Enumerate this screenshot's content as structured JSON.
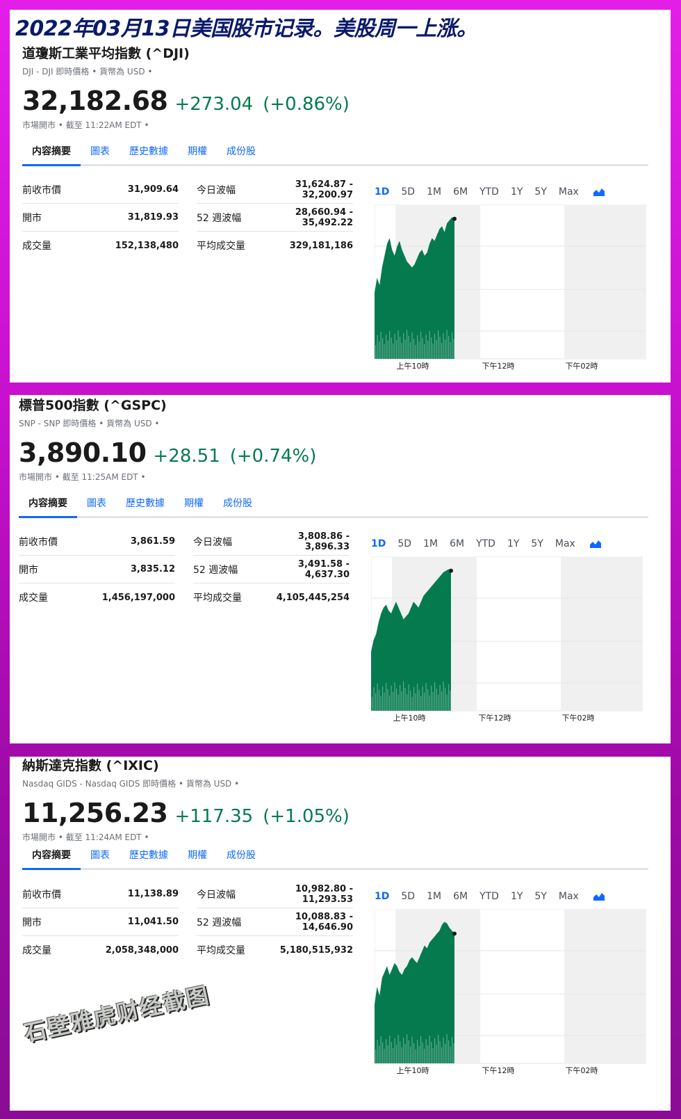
{
  "headline": "2022年03月13日美国股市记录。美股周一上涨。",
  "watermark": "石壁雅虎财经截图",
  "tabs": [
    "内容摘要",
    "圖表",
    "歷史數據",
    "期權",
    "成份股"
  ],
  "ranges": [
    "1D",
    "5D",
    "1M",
    "6M",
    "YTD",
    "1Y",
    "5Y",
    "Max"
  ],
  "x_labels": [
    "上午10時",
    "下午12時",
    "下午02時"
  ],
  "colors": {
    "up": "#067a4f",
    "link": "#0f69ff",
    "chart_fill": "#067a4f",
    "bg": "#d11bd6"
  },
  "quotes": [
    {
      "title": "道瓊斯工業平均指數 (^DJI)",
      "sub": "DJI - DJI 即時價格 • 貨幣為 USD •",
      "price": "32,182.68",
      "change": "+273.04",
      "pct": "(+0.86%)",
      "status": "市場開市 •  截至 11:22AM EDT •",
      "stats_left": [
        {
          "label": "前收市價",
          "value": "31,909.64"
        },
        {
          "label": "開市",
          "value": "31,819.93"
        },
        {
          "label": "成交量",
          "value": "152,138,480"
        }
      ],
      "stats_right": [
        {
          "label": "今日波幅",
          "value1": "31,624.87 -",
          "value2": "32,200.97"
        },
        {
          "label": "52 週波幅",
          "value1": "28,660.94 -",
          "value2": "35,492.22"
        },
        {
          "label": "平均成交量",
          "value1": "329,181,186",
          "value2": ""
        }
      ]
    },
    {
      "title": "標普500指數 (^GSPC)",
      "sub": "SNP - SNP 即時價格 • 貨幣為 USD •",
      "price": "3,890.10",
      "change": "+28.51",
      "pct": "(+0.74%)",
      "status": "市場開市 •  截至 11:25AM EDT •",
      "stats_left": [
        {
          "label": "前收市價",
          "value": "3,861.59"
        },
        {
          "label": "開市",
          "value": "3,835.12"
        },
        {
          "label": "成交量",
          "value": "1,456,197,000"
        }
      ],
      "stats_right": [
        {
          "label": "今日波幅",
          "value1": "3,808.86 -",
          "value2": "3,896.33"
        },
        {
          "label": "52 週波幅",
          "value1": "3,491.58 -",
          "value2": "4,637.30"
        },
        {
          "label": "平均成交量",
          "value1": "4,105,445,254",
          "value2": ""
        }
      ]
    },
    {
      "title": "納斯達克指數 (^IXIC)",
      "sub": "Nasdaq GIDS - Nasdaq GIDS 即時價格 • 貨幣為 USD •",
      "price": "11,256.23",
      "change": "+117.35",
      "pct": "(+1.05%)",
      "status": "市場開市 •  截至 11:24AM EDT •",
      "stats_left": [
        {
          "label": "前收市價",
          "value": "11,138.89"
        },
        {
          "label": "開市",
          "value": "11,041.50"
        },
        {
          "label": "成交量",
          "value": "2,058,348,000"
        }
      ],
      "stats_right": [
        {
          "label": "今日波幅",
          "value1": "10,982.80 -",
          "value2": "11,293.53"
        },
        {
          "label": "52 週波幅",
          "value1": "10,088.83 -",
          "value2": "14,646.90"
        },
        {
          "label": "平均成交量",
          "value1": "5,180,515,932",
          "value2": ""
        }
      ]
    }
  ]
}
